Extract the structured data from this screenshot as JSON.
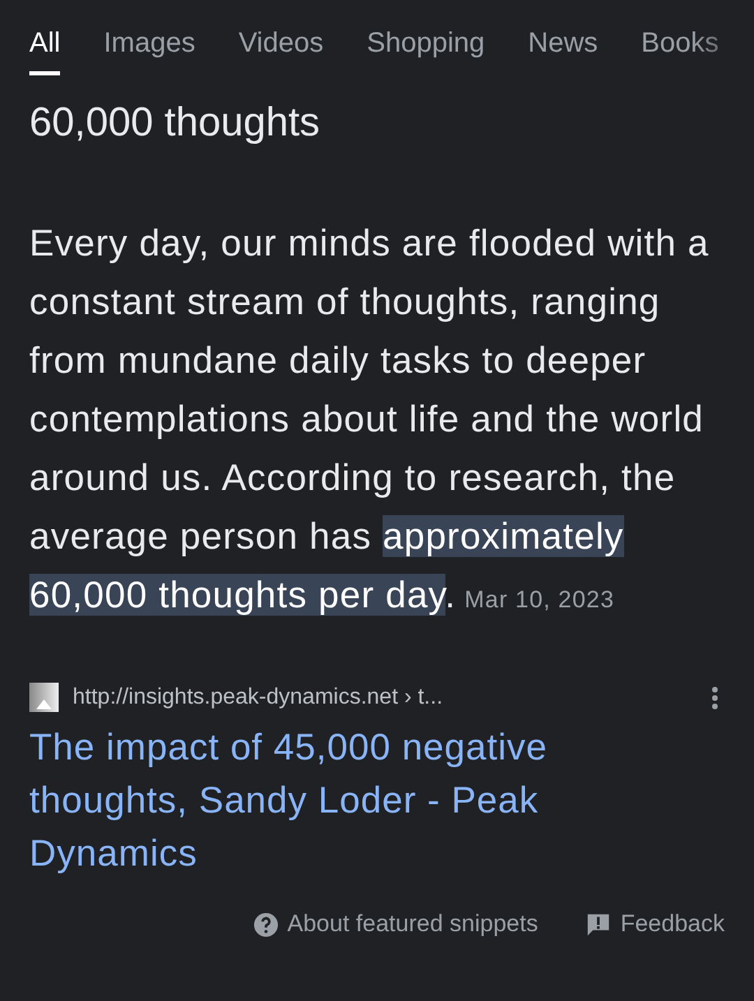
{
  "tabs": [
    {
      "label": "All",
      "selected": true
    },
    {
      "label": "Images",
      "selected": false
    },
    {
      "label": "Videos",
      "selected": false
    },
    {
      "label": "Shopping",
      "selected": false
    },
    {
      "label": "News",
      "selected": false
    },
    {
      "label": "Books",
      "selected": false
    }
  ],
  "heading": "60,000 thoughts",
  "snippet": {
    "before": "Every day, our minds are flooded with a constant stream of thoughts, ranging from mundane daily tasks to deeper contemplations about life and the world around us. According to research, the average person has ",
    "highlight": "approximately 60,000 thoughts per day",
    "after": ".",
    "date": "Mar 10, 2023"
  },
  "source": {
    "url": "http://insights.peak-dynamics.net › t...",
    "title": "The impact of 45,000 negative thoughts, Sandy Loder - Peak Dynamics"
  },
  "footer": {
    "about": "About featured snippets",
    "feedback": "Feedback"
  }
}
